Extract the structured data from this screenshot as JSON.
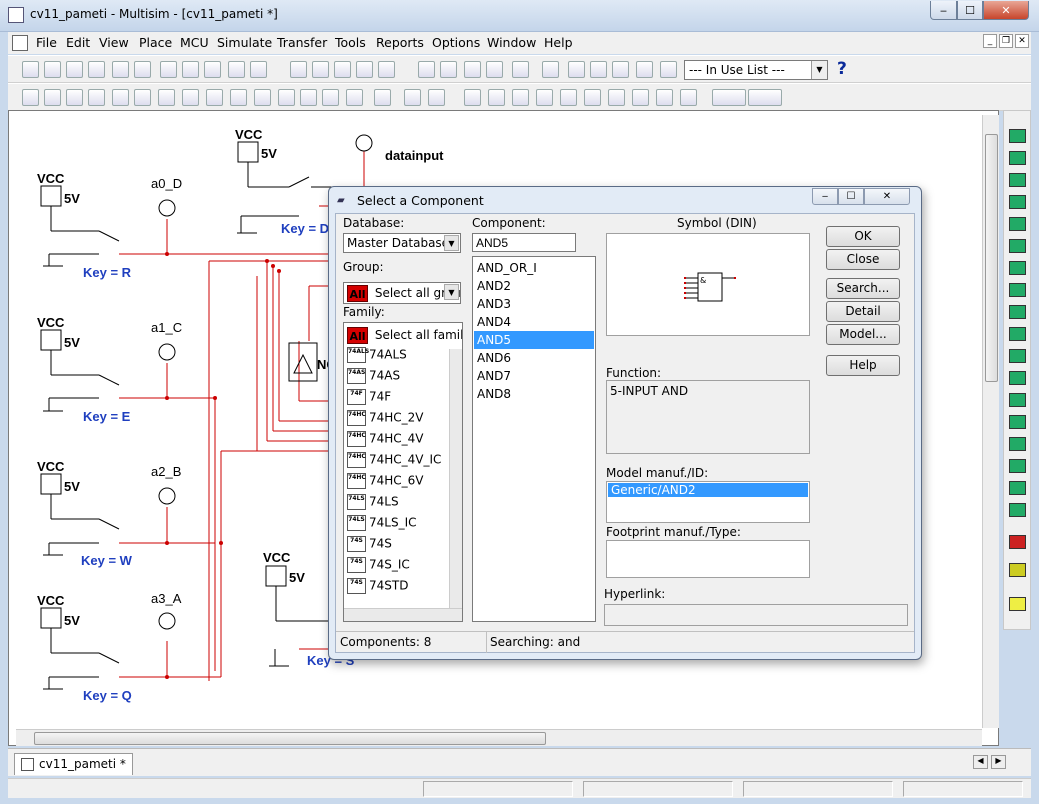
{
  "window": {
    "title": "cv11_pameti - Multisim - [cv11_pameti *]",
    "caption_min": "‒",
    "caption_max": "☐",
    "caption_close": "✕"
  },
  "menu": {
    "items": [
      "File",
      "Edit",
      "View",
      "Place",
      "MCU",
      "Simulate",
      "Transfer",
      "Tools",
      "Reports",
      "Options",
      "Window",
      "Help"
    ],
    "mdi_min": "_",
    "mdi_restore": "❐",
    "mdi_close": "✕"
  },
  "toolbar": {
    "in_use_list": "--- In Use List ---",
    "help_symbol": "?"
  },
  "circuit": {
    "vcc_label": "VCC",
    "vcc_value": "5V",
    "probes": [
      "datainput",
      "a0_D",
      "a1_C",
      "a2_B",
      "a3_A"
    ],
    "keys": [
      "Key = D",
      "Key = R",
      "Key = E",
      "Key = W",
      "Key = Q",
      "Key = S"
    ],
    "partial_label": "NO",
    "wire_color": "#cc0000",
    "key_color": "#1f3fbf"
  },
  "tabs": {
    "document": "cv11_pameti *"
  },
  "dialog": {
    "title": "Select a Component",
    "database_label": "Database:",
    "database_value": "Master Database",
    "group_label": "Group:",
    "group_value": "Select all group",
    "family_label": "Family:",
    "all_icon": "All",
    "families": [
      {
        "icon": "74ALS",
        "label": "74ALS"
      },
      {
        "icon": "74AS",
        "label": "74AS"
      },
      {
        "icon": "74F",
        "label": "74F"
      },
      {
        "icon": "74HC",
        "label": "74HC_2V"
      },
      {
        "icon": "74HC",
        "label": "74HC_4V"
      },
      {
        "icon": "74HC",
        "label": "74HC_4V_IC"
      },
      {
        "icon": "74HC",
        "label": "74HC_6V"
      },
      {
        "icon": "74LS",
        "label": "74LS"
      },
      {
        "icon": "74LS",
        "label": "74LS_IC"
      },
      {
        "icon": "74S",
        "label": "74S"
      },
      {
        "icon": "74S",
        "label": "74S_IC"
      },
      {
        "icon": "74S",
        "label": "74STD"
      }
    ],
    "family_all": "Select all familie",
    "component_label": "Component:",
    "component_value": "AND5",
    "components": [
      "AND_OR_I",
      "AND2",
      "AND3",
      "AND4",
      "AND5",
      "AND6",
      "AND7",
      "AND8"
    ],
    "selected_component": "AND5",
    "symbol_label": "Symbol (DIN)",
    "symbol_gate_text": "&",
    "function_label": "Function:",
    "function_value": "5-INPUT AND",
    "model_label": "Model manuf./ID:",
    "model_value": "Generic/AND2",
    "footprint_label": "Footprint manuf./Type:",
    "hyperlink_label": "Hyperlink:",
    "buttons": {
      "ok": "OK",
      "close": "Close",
      "search": "Search...",
      "detail_report": "Detail Report",
      "model": "Model...",
      "help": "Help"
    },
    "status_components": "Components: 8",
    "status_searching": "Searching: and"
  }
}
